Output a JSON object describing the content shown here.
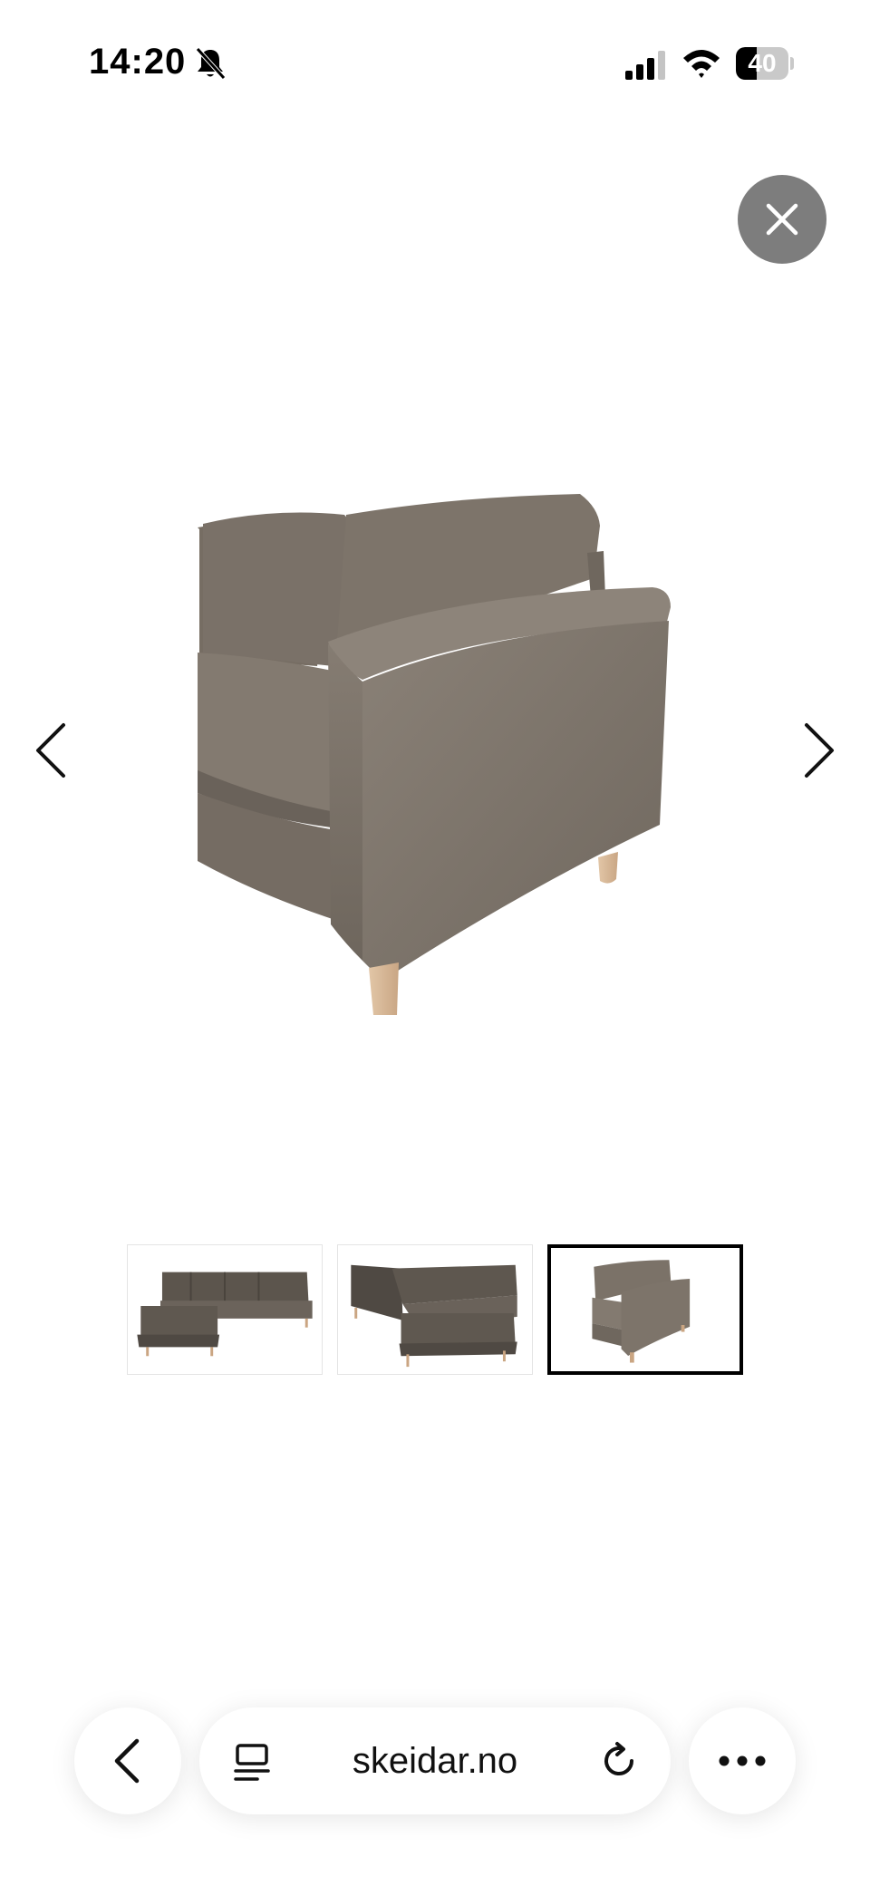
{
  "status_bar": {
    "time": "14:20",
    "battery_level": "40",
    "battery_fraction": 0.4,
    "icons": [
      "bell-slash-icon",
      "cellular-signal-icon",
      "wifi-icon",
      "battery-icon"
    ]
  },
  "gallery": {
    "close_icon": "close-icon",
    "prev_icon": "chevron-left-icon",
    "next_icon": "chevron-right-icon",
    "main_image": "sofa-armrest-closeup",
    "thumbnails": [
      {
        "image": "corner-sofa-front",
        "active": false
      },
      {
        "image": "corner-sofa-angle",
        "active": false
      },
      {
        "image": "sofa-armrest-closeup",
        "active": true
      }
    ]
  },
  "browser_bar": {
    "url": "skeidar.no",
    "icons": [
      "back-icon",
      "reader-mode-icon",
      "reload-icon",
      "more-icon"
    ]
  },
  "colors": {
    "fabric": "#7b7268",
    "fabric_dark": "#5e564e",
    "leg": "#d8b99a",
    "close_bg": "#7d7d7d"
  }
}
